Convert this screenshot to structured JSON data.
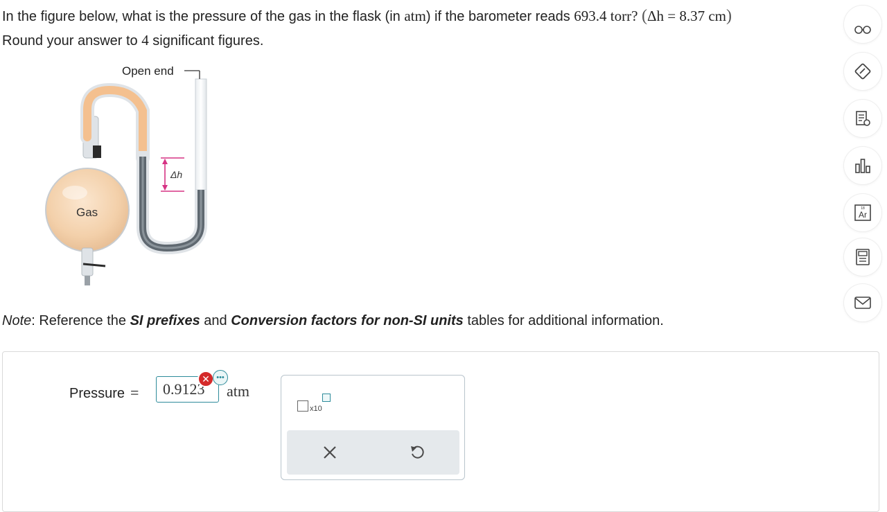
{
  "question": {
    "part1": "In the figure below, what is the pressure of the gas in the flask (in ",
    "unit_atm": "atm",
    "part2": ") if the barometer reads ",
    "barometer_value": "693.4 torr?",
    "delta_open": "(",
    "delta_expr": "Δh = 8.37 cm",
    "delta_close": ")",
    "line2_a": "Round your answer to ",
    "sig_figs": "4",
    "line2_b": " significant figures."
  },
  "figure": {
    "open_end_label": "Open end",
    "delta_h_label": "Δh",
    "gas_label": "Gas",
    "colors": {
      "gas": "#f6d7b6",
      "tube_orange": "#f4c08f",
      "mercury": "#5f6870",
      "bracket": "#d63384"
    }
  },
  "note": {
    "prefix": "Note",
    "text1": ": Reference the ",
    "link1": "SI prefixes",
    "text2": " and ",
    "link2": "Conversion factors for non-SI units",
    "text3": " tables for additional information."
  },
  "answer": {
    "label": "Pressure",
    "equals": "=",
    "value": "0.9123",
    "unit": "atm",
    "status": "incorrect",
    "error_icon": "error-x-icon",
    "more_icon": "ellipsis-icon"
  },
  "toolbox": {
    "x10_label": "x10",
    "clear_icon": "close-icon",
    "undo_icon": "undo-icon"
  },
  "side_tools": [
    {
      "name": "glasses-icon"
    },
    {
      "name": "pencil-diamond-icon"
    },
    {
      "name": "notes-icon"
    },
    {
      "name": "bar-chart-icon"
    },
    {
      "name": "periodic-table-icon"
    },
    {
      "name": "calculator-icon"
    },
    {
      "name": "mail-icon"
    }
  ],
  "periodic_symbol": "Ar",
  "colors": {
    "accent": "#2d8b9a",
    "error": "#d42a2a"
  }
}
